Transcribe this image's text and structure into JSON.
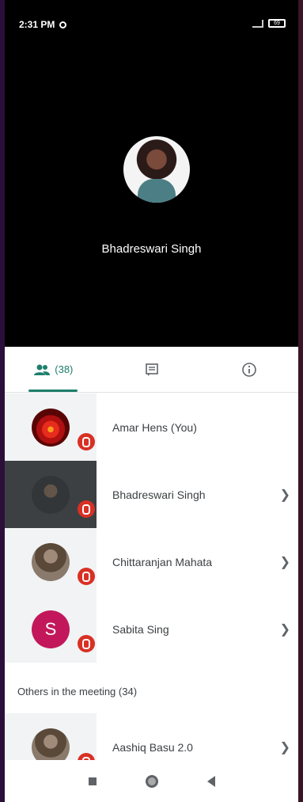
{
  "status": {
    "time": "2:31 PM",
    "battery": "69"
  },
  "speaker": {
    "name": "Bhadreswari Singh"
  },
  "tabs": [
    {
      "label": "(38)",
      "icon": "people-icon",
      "active": true
    },
    {
      "label": "",
      "icon": "chat-icon",
      "active": false
    },
    {
      "label": "",
      "icon": "info-icon",
      "active": false
    }
  ],
  "participants": [
    {
      "name": "Amar Hens (You)",
      "muted": true
    },
    {
      "name": "Bhadreswari Singh",
      "muted": true
    },
    {
      "name": "Chittaranjan Mahata",
      "muted": true
    },
    {
      "name": "Sabita Sing",
      "initial": "S",
      "muted": true
    }
  ],
  "others": {
    "label": "Others in the meeting (34)"
  },
  "others_list": [
    {
      "name": "Aashiq Basu 2.0",
      "muted": true
    }
  ],
  "colors": {
    "accent": "#1e7e6b",
    "mic_muted": "#d93025",
    "avatar_S": "#c2185b"
  }
}
